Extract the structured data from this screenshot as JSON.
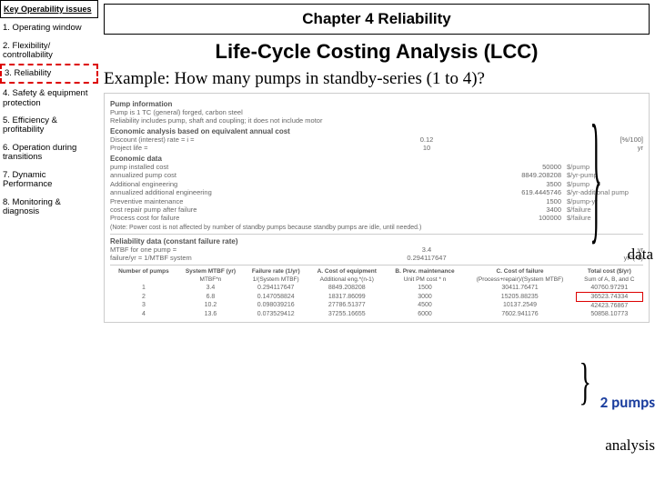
{
  "sidebar": {
    "header": "Key Operability issues",
    "items": [
      "1. Operating window",
      "2. Flexibility/ controllability",
      "3. Reliability",
      "4. Safety & equipment protection",
      "5. Efficiency & profitability",
      "6. Operation during transitions",
      "7. Dynamic Performance",
      "8. Monitoring & diagnosis"
    ],
    "active_index": 2
  },
  "main": {
    "chapter": "Chapter 4 Reliability",
    "title": "Life-Cycle Costing Analysis (LCC)",
    "example": "Example: How many pumps in standby-series (1 to 4)?"
  },
  "labels": {
    "data": "data",
    "two_pumps": "2 pumps",
    "analysis": "analysis"
  },
  "fig": {
    "pump_info_head": "Pump information",
    "pump_desc": "Pump is 1 TC (general) forged, carbon steel",
    "pump_reliab": "Reliability includes pump, shaft and coupling; it does not include motor",
    "econ_head": "Economic analysis based on equivalent annual cost",
    "discount_label": "Discount (interest) rate = i =",
    "discount_val": "0.12",
    "discount_unit": "[%/100]",
    "proj_label": "Project life =",
    "proj_val": "10",
    "proj_unit": "yr",
    "econdata_head": "Economic data",
    "rows": [
      {
        "l": "pump installed cost",
        "m": "50000",
        "r": "$/pump"
      },
      {
        "l": "annualized pump cost",
        "m": "8849.208208",
        "r": "$/yr-pump"
      },
      {
        "l": "Additional engineering",
        "m": "3500",
        "r": "$/pump"
      },
      {
        "l": "annualized additional engineering",
        "m": "619.4445746",
        "r": "$/yr-additional pump"
      },
      {
        "l": "Preventive maintenance",
        "m": "1500",
        "r": "$/pump-yr"
      },
      {
        "l": "cost repair pump after failure",
        "m": "3400",
        "r": "$/failure"
      },
      {
        "l": "Process cost for failure",
        "m": "100000",
        "r": "$/failure"
      }
    ],
    "note": "(Note: Power cost is not affected by number of standby pumps because standby pumps are idle, until needed.)",
    "reliab_head": "Reliability data    (constant failure rate)",
    "mtbf_one_label": "MTBF for one pump =",
    "mtbf_one_val": "3.4",
    "mtbf_one_unit": "yr",
    "fail_label": "failure/yr = 1/MTBF system",
    "fail_val": "0.294117647",
    "fail_unit": "yr^(-1)",
    "thead": [
      "Number of pumps",
      "System MTBF (yr)",
      "Failure rate (1/yr)",
      "A. Cost of equipment",
      "B. Prev. maintenance",
      "C. Cost of failure",
      "Total cost ($/yr)"
    ],
    "tsub": [
      "",
      "MTBF*n",
      "1/(System MTBF)",
      "Additional eng.*(n-1)",
      "Unit PM cost * n",
      "(Process+repair)/(System MTBF)",
      "Sum of A, B, and C"
    ],
    "trows": [
      [
        "1",
        "3.4",
        "0.294117647",
        "8849.208208",
        "1500",
        "30411.76471",
        "40760.97291"
      ],
      [
        "2",
        "6.8",
        "0.147058824",
        "18317.86099",
        "3000",
        "15205.88235",
        "36523.74334"
      ],
      [
        "3",
        "10.2",
        "0.098039216",
        "27786.51377",
        "4500",
        "10137.2549",
        "42423.76867"
      ],
      [
        "4",
        "13.6",
        "0.073529412",
        "37255.16655",
        "6000",
        "7602.941176",
        "50858.10773"
      ]
    ]
  }
}
